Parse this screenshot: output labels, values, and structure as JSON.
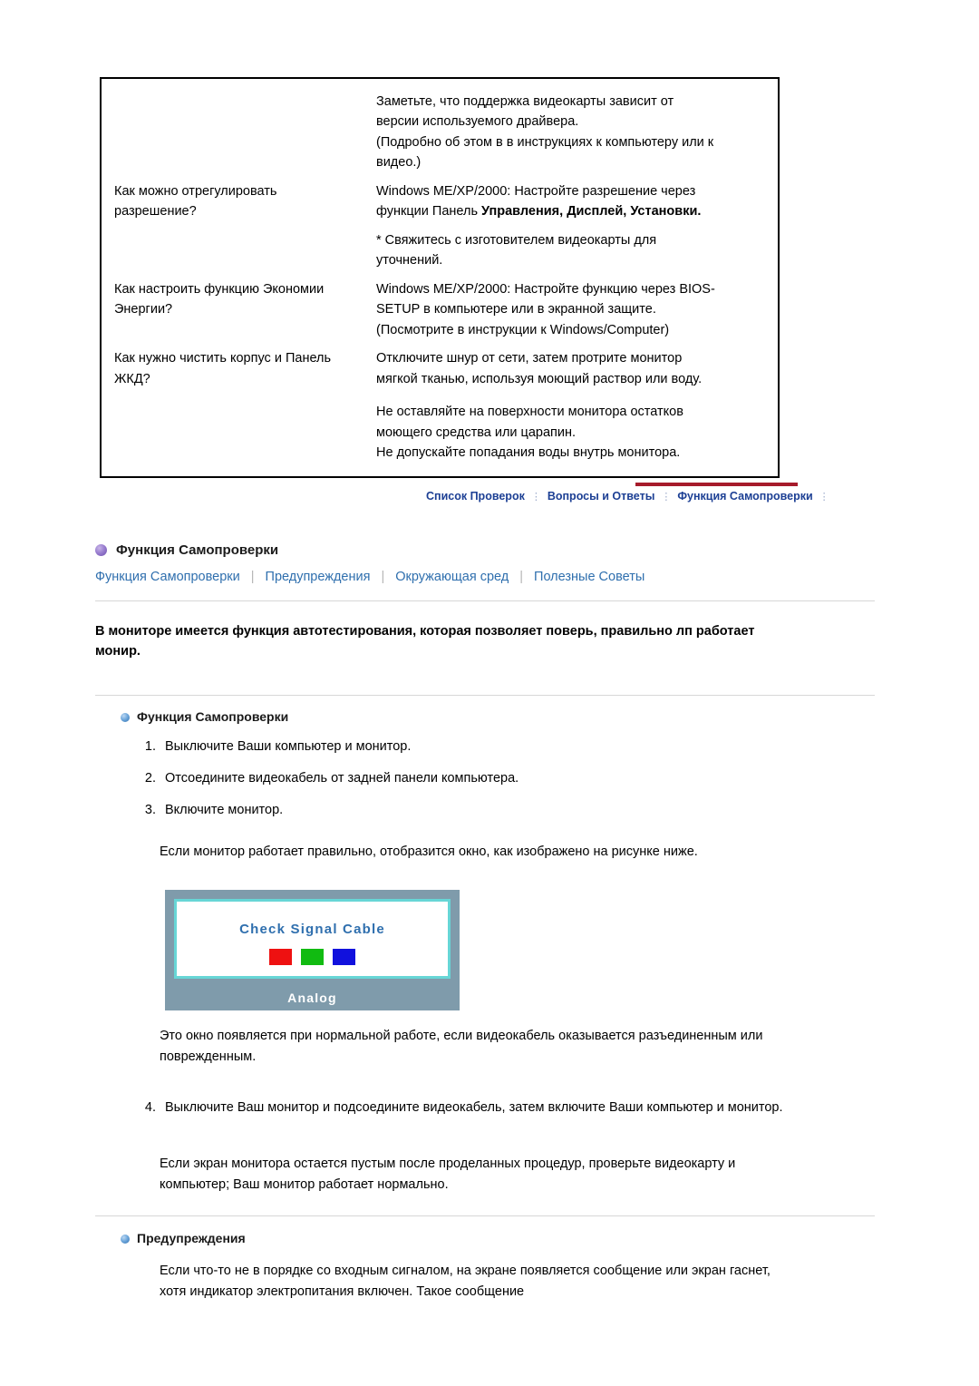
{
  "faq": {
    "rows": [
      {
        "question": "",
        "answer": [
          "Заметьте, что поддержка видеокарты зависит от",
          "версии используемого драйвера.",
          "(Подробно об этом в в инструкциях к компьютеру или к",
          "видео.)"
        ]
      },
      {
        "question_lines": [
          "Как можно отрегулировать",
          "разрешение?"
        ],
        "answer_lines": [
          "Windows ME/XP/2000: Настройте разрешение через"
        ],
        "answer_bold_line": {
          "prefix": "функции Панель ",
          "b1": "Управления",
          "mid1": ", ",
          "b2": "Дисплей",
          "mid2": ", ",
          "b3": "Установки."
        },
        "answer_after": [
          "* Свяжитесь с изготовителем видеокарты для",
          "уточнений."
        ]
      },
      {
        "question_lines": [
          "Как настроить функцию Экономии",
          "Энергии?"
        ],
        "answer_lines": [
          "Windows ME/XP/2000: Настройте функцию через BIOS-",
          "SETUP в компьютере или в экранной защите.",
          "(Посмотрите в инструкции к Windows/Computer)"
        ]
      },
      {
        "question_lines": [
          "Как нужно чистить корпус и Панель",
          "ЖКД?"
        ],
        "answer_lines": [
          "Отключите шнур от сети, затем протрите монитор",
          "мягкой тканью, используя моющий раствор или воду.",
          "",
          "Не оставляйте на поверхности монитора остатков",
          "моющего средства или царапин.",
          "Не допускайте попадания воды внутрь монитора."
        ]
      }
    ]
  },
  "navstrip": {
    "item1": "Список Проверок",
    "item2": "Вопросы и Ответы",
    "item3": "Функция Самопроверки",
    "sep": "⋮"
  },
  "section": {
    "title": "Функция Самопроверки",
    "subnav": [
      "Функция Самопроверки",
      "Предупреждения",
      "Окружающая сред",
      "Полезные Советы"
    ],
    "subnav_sep": "|",
    "intro": "В мониторе имеется функция автотестирования, которая позволяет поверь, правильно лп работает монир.",
    "sub1_title": "Функция Самопроверки",
    "steps": [
      "Выключите Ваши компьютер и монитор.",
      "Отсоедините видеокабель от задней панели компьютера.",
      "Включите монитор."
    ],
    "after_step3": "Если монитор работает правильно, отобразится окно, как изображено на рисунке ниже.",
    "monitor_image": {
      "message": "Check Signal Cable",
      "label": "Analog",
      "swatch_red": "#ee1111",
      "swatch_green": "#11bb11",
      "swatch_blue": "#1111dd",
      "screen_border": "#67d6d6",
      "bezel": "#7f9bab"
    },
    "after_image": "Это окно появляется при нормальной работе, если видеокабель оказывается разъединенным или поврежденным.",
    "step4": "Выключите Ваш монитор и подсоедините видеокабель, затем включите Ваши компьютер и монитор.",
    "after_step4": "Если экран монитора остается пустым после проделанных процедур, проверьте видеокарту и компьютер; Ваш монитор работает нормально.",
    "sub2_title": "Предупреждения",
    "warn_text": "Если что-то не в порядке со входным сигналом, на экране появляется сообщение или экран гаснет, хотя индикатор электропитания включен. Такое сообщение"
  },
  "colors": {
    "accent_red": "#a61b2b",
    "link_blue": "#2f6fae",
    "nav_blue": "#1c3f94"
  }
}
